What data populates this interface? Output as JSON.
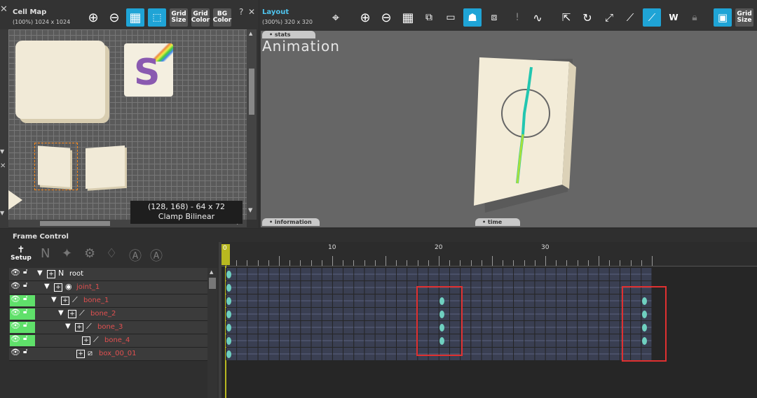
{
  "cell_map": {
    "title": "Cell Map",
    "subtitle": "(100%) 1024 x 1024",
    "close_glyph": "✕",
    "help_glyph": "?",
    "btn_grid_size": [
      "Grid",
      "Size"
    ],
    "btn_grid_color": [
      "Grid",
      "Color"
    ],
    "btn_bg_color": [
      "BG",
      "Color"
    ],
    "info_coords": "(128, 168) - 64 x 72",
    "info_filter": "Clamp  Bilinear",
    "sticker_letter": "S"
  },
  "layout": {
    "title": "Layout",
    "subtitle": "(300%) 320 x 320",
    "mode_label": "Animation",
    "tab_stats": "• stats",
    "tab_information": "• information",
    "tab_time": "• time",
    "btn_grid_size": [
      "Grid",
      "Size"
    ]
  },
  "frame_control": {
    "title": "Frame Control",
    "setup_label": "Setup",
    "ruler_labels": [
      "0",
      "10",
      "20",
      "30"
    ],
    "current_frame": 0,
    "tree": [
      {
        "name": "root",
        "color": "#ffffff",
        "visible_highlight": false
      },
      {
        "name": "joint_1",
        "color": "#e05050",
        "visible_highlight": false
      },
      {
        "name": "bone_1",
        "color": "#e05050",
        "visible_highlight": true
      },
      {
        "name": "bone_2",
        "color": "#e05050",
        "visible_highlight": true
      },
      {
        "name": "bone_3",
        "color": "#e05050",
        "visible_highlight": true
      },
      {
        "name": "bone_4",
        "color": "#e05050",
        "visible_highlight": true
      },
      {
        "name": "box_00_01",
        "color": "#e05050",
        "visible_highlight": false
      }
    ],
    "keyframes": [
      {
        "row": 0,
        "frames": [
          0
        ]
      },
      {
        "row": 1,
        "frames": [
          0
        ]
      },
      {
        "row": 2,
        "frames": [
          0,
          20,
          39
        ]
      },
      {
        "row": 3,
        "frames": [
          0,
          20,
          39
        ]
      },
      {
        "row": 4,
        "frames": [
          0,
          20,
          39
        ]
      },
      {
        "row": 5,
        "frames": [
          0,
          20,
          39
        ]
      },
      {
        "row": 6,
        "frames": [
          0
        ]
      }
    ],
    "total_frames": 40
  },
  "colors": {
    "accent": "#1fa4d6",
    "visible_green": "#5fe06a",
    "key_color": "#6fd0c0",
    "highlight_red": "#e03030",
    "node_red": "#e05050"
  }
}
